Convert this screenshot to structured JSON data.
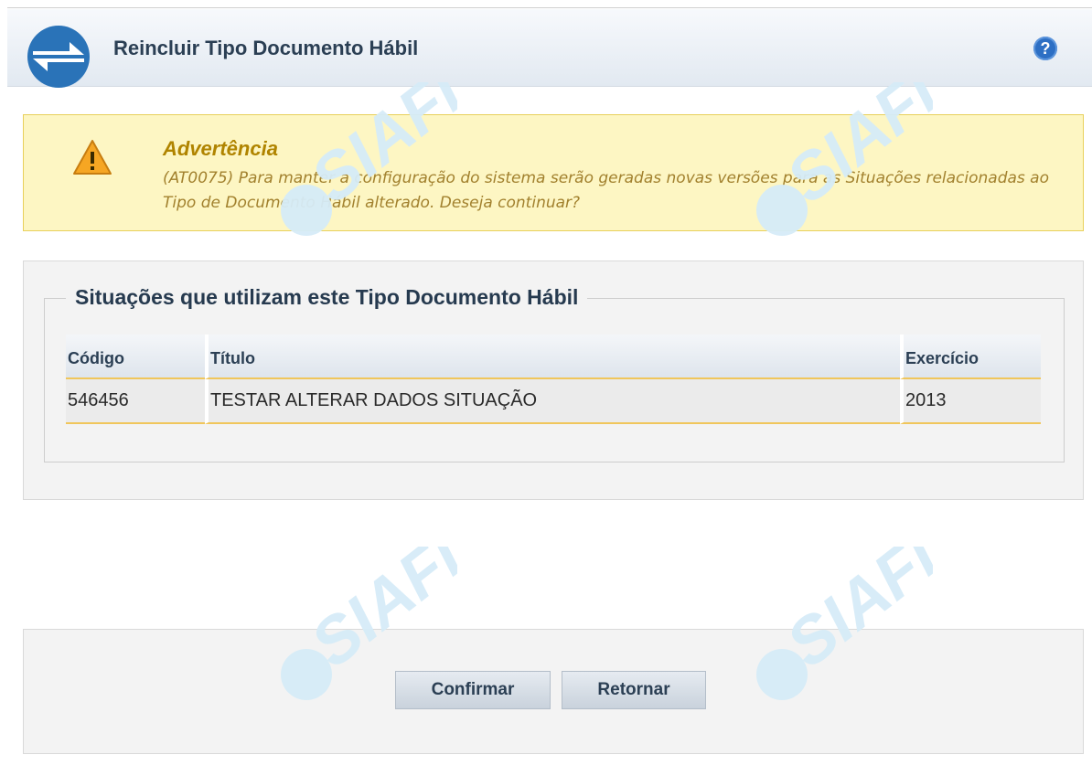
{
  "header": {
    "title": "Reincluir Tipo Documento Hábil",
    "help_label": "?",
    "logo_icon": "siafi-logo-icon",
    "help_icon": "help-icon"
  },
  "warning": {
    "title": "Advertência",
    "message": "(AT0075) Para manter a configuração do sistema serão geradas novas versões para as Situações relacionadas ao Tipo de Documento Hábil alterado. Deseja continuar?",
    "icon": "warning-triangle-icon",
    "background": "#fdf6c3",
    "border": "#e8d05b"
  },
  "situations": {
    "legend": "Situações que utilizam este Tipo Documento Hábil",
    "columns": [
      "Código",
      "Título",
      "Exercício"
    ],
    "rows": [
      {
        "codigo": "546456",
        "titulo": "TESTAR ALTERAR DADOS SITUAÇÃO",
        "exercicio": "2013"
      }
    ]
  },
  "actions": {
    "confirm_label": "Confirmar",
    "return_label": "Retornar"
  },
  "watermark": {
    "text": "SIAFI",
    "color": "#cfe8f7"
  },
  "colors": {
    "accent_border": "#f0c65b",
    "title_text": "#2b3f54"
  }
}
